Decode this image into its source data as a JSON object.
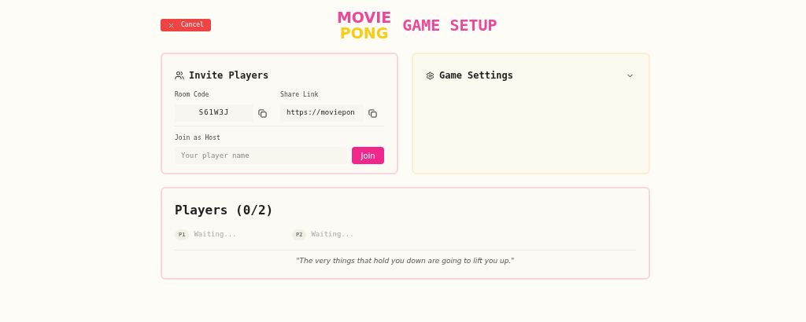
{
  "header": {
    "cancel_button": "Cancel",
    "logo": {
      "top": "MOVIE",
      "bottom": "PONG"
    },
    "title": "GAME SETUP"
  },
  "invite": {
    "title": "Invite Players",
    "room_code": {
      "label": "Room Code",
      "value": "S61W3J"
    },
    "share_link": {
      "label": "Share Link",
      "value": "https://moviepon"
    },
    "join": {
      "label": "Join as Host",
      "placeholder": "Your player name",
      "button": "Join"
    }
  },
  "settings": {
    "title": "Game Settings",
    "expanded": false
  },
  "players": {
    "title": "Players (0/2)",
    "slots": [
      {
        "badge": "P1",
        "status": "Waiting...",
        "filled": false
      },
      {
        "badge": "P2",
        "status": "Waiting...",
        "filled": false
      }
    ],
    "quote": "\"The very things that hold you down are going to lift you up.\""
  }
}
